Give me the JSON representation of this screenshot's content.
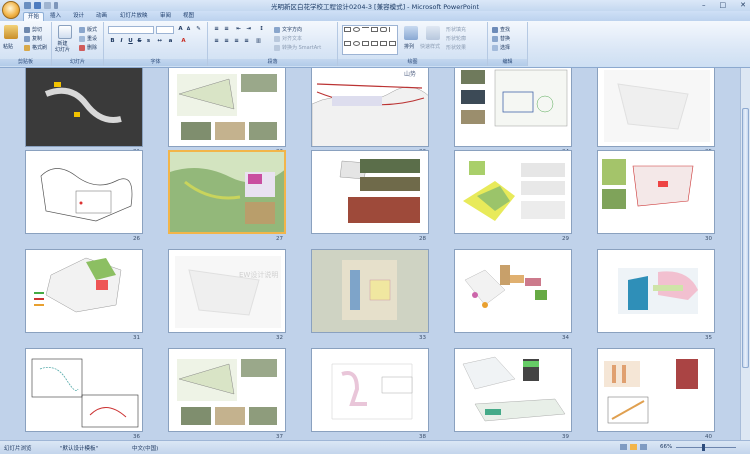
{
  "window": {
    "title": "光明新区白花学校工程设计0204-3 [兼容模式] - Microsoft PowerPoint"
  },
  "tabs": [
    "开始",
    "插入",
    "设计",
    "动画",
    "幻灯片放映",
    "审阅",
    "视图"
  ],
  "ribbon": {
    "clipboard": {
      "paste": "粘贴",
      "cut": "剪切",
      "copy": "复制",
      "format_painter": "格式刷",
      "label": "剪贴板"
    },
    "slides": {
      "new": "新建\n幻灯片",
      "layout": "版式",
      "reset": "重设",
      "delete": "删除",
      "label": "幻灯片"
    },
    "font": {
      "label": "字体"
    },
    "paragraph": {
      "text_direction": "文字方向",
      "align_text": "对齐文本",
      "convert_smartart": "转换为 SmartArt",
      "label": "段落"
    },
    "drawing": {
      "arrange": "排列",
      "quick_styles": "快速样式",
      "shape_fill": "形状填充",
      "shape_outline": "形状轮廓",
      "shape_effects": "形状效果",
      "label": "绘图"
    },
    "editing": {
      "find": "查找",
      "replace": "替换",
      "select": "选择",
      "label": "编辑"
    }
  },
  "slides": [
    {
      "num": "21",
      "theme": "dark"
    },
    {
      "num": "22",
      "theme": "site"
    },
    {
      "num": "23",
      "theme": "mountain",
      "caption": "山势"
    },
    {
      "num": "24",
      "theme": "plan"
    },
    {
      "num": "25",
      "theme": "faint"
    },
    {
      "num": "26",
      "theme": "sketch"
    },
    {
      "num": "27",
      "theme": "green",
      "selected": true
    },
    {
      "num": "28",
      "theme": "photos"
    },
    {
      "num": "29",
      "theme": "terrain"
    },
    {
      "num": "30",
      "theme": "diagram"
    },
    {
      "num": "31",
      "theme": "map"
    },
    {
      "num": "32",
      "theme": "faint",
      "caption": "EW设计说明"
    },
    {
      "num": "33",
      "theme": "aerial"
    },
    {
      "num": "34",
      "theme": "colorful"
    },
    {
      "num": "35",
      "theme": "blue"
    },
    {
      "num": "36",
      "theme": "lines"
    },
    {
      "num": "37",
      "theme": "site"
    },
    {
      "num": "38",
      "theme": "plan2"
    },
    {
      "num": "39",
      "theme": "3d"
    },
    {
      "num": "40",
      "theme": "section"
    }
  ],
  "status": {
    "view": "幻灯片浏览",
    "theme": "\"默认设计模板\"",
    "language": "中文(中国)",
    "zoom": "66%"
  }
}
